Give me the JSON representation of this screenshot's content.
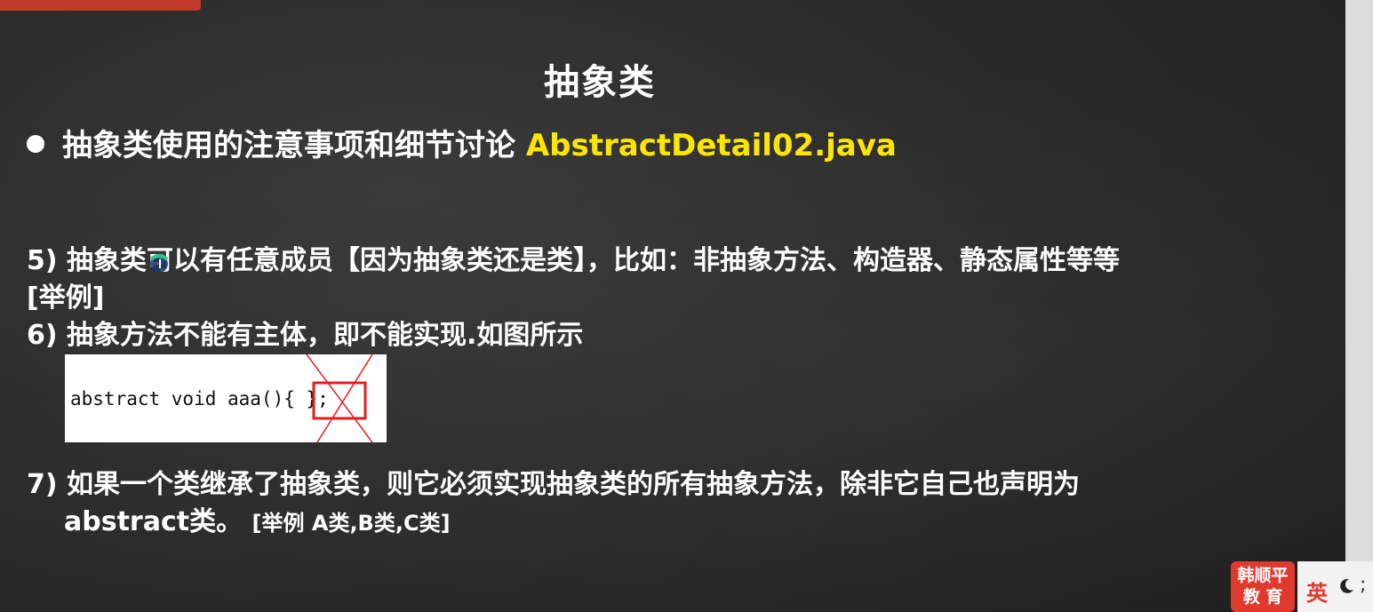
{
  "slide": {
    "title": "抽象类",
    "bullet_text": "抽象类使用的注意事项和细节讨论 ",
    "filename": "AbstractDetail02.java",
    "point5_line1": "5) 抽象类可以有任意成员【因为抽象类还是类】，比如：非抽象方法、构造器、静态属性等等",
    "point5_line2": "[举例]",
    "point6": "6) 抽象方法不能有主体，即不能实现.如图所示",
    "code_sample": "abstract void aaa(){  };",
    "point7_line1": "7) 如果一个类继承了抽象类，则它必须实现抽象类的所有抽象方法，除非它自己也声明为",
    "point7_line2_main": "abstract类。",
    "point7_line2_example": "[举例 A类,B类,C类]"
  },
  "logo": {
    "line1": "韩顺平",
    "line2": "教 育"
  },
  "ime": {
    "language": "英",
    "punctuation": ";"
  },
  "colors": {
    "filename": "#ffe600",
    "cross_mark": "#e02020",
    "logo_bg": "#e03a2f"
  },
  "icons": {
    "cursor": "pointer-cursor-icon",
    "moon": "moon-icon"
  }
}
